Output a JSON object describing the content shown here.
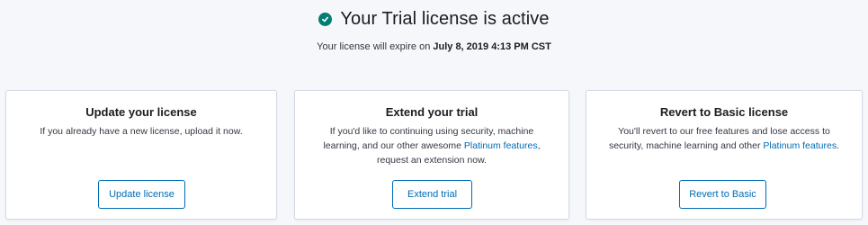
{
  "header": {
    "status_icon": "check-circle-icon",
    "status_color": "#017d73",
    "title": "Your Trial license is active",
    "expiry_prefix": "Your license will expire on ",
    "expiry_date": "July 8, 2019 4:13 PM CST"
  },
  "cards": [
    {
      "title": "Update your license",
      "description": "If you already have a new license, upload it now.",
      "button_label": "Update license"
    },
    {
      "title": "Extend your trial",
      "description_pre": "If you'd like to continuing using security, machine learning, and our other awesome ",
      "description_link": "Platinum features",
      "description_post": ", request an extension now.",
      "button_label": "Extend trial"
    },
    {
      "title": "Revert to Basic license",
      "description_pre": "You'll revert to our free features and lose access to security, machine learning and other ",
      "description_link": "Platinum features",
      "description_post": ".",
      "button_label": "Revert to Basic"
    }
  ],
  "colors": {
    "accent": "#006bb4",
    "background": "#f5f7fa",
    "card_border": "#d3dae6"
  }
}
